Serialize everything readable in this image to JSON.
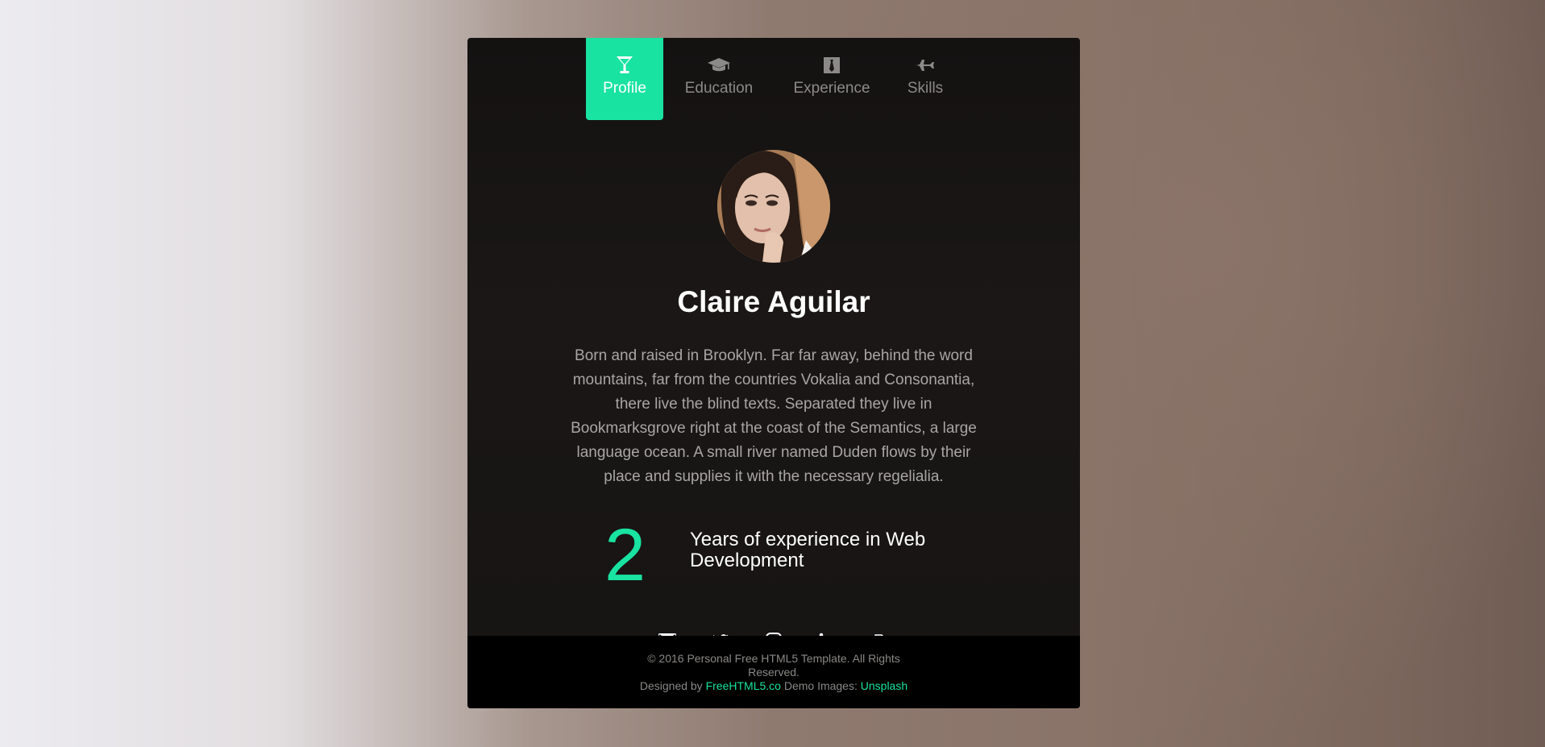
{
  "tabs": [
    {
      "label": "Profile",
      "icon": "cocktail-icon",
      "active": true
    },
    {
      "label": "Education",
      "icon": "graduation-cap-icon",
      "active": false
    },
    {
      "label": "Experience",
      "icon": "briefcase-icon",
      "active": false
    },
    {
      "label": "Skills",
      "icon": "airplane-icon",
      "active": false
    }
  ],
  "profile": {
    "name": "Claire Aguilar",
    "bio": "Born and raised in Brooklyn. Far far away, behind the word mountains, far from the countries Vokalia and Consonantia, there live the blind texts. Separated they live in Bookmarksgrove right at the coast of the Semantics, a large language ocean. A small river named Duden flows by their place and supplies it with the necessary regelialia.",
    "years_value": "2",
    "years_label": "Years of experience in Web Development"
  },
  "social": [
    "envelope-icon",
    "twitter-icon",
    "instagram-icon",
    "linkedin-icon",
    "file-download-icon"
  ],
  "footer": {
    "copyright": "© 2016 Personal Free HTML5 Template. All Rights Reserved.",
    "designed_by_prefix": "Designed by",
    "designed_by_link": "FreeHTML5.co",
    "images_prefix": "Demo Images:",
    "images_link": "Unsplash"
  },
  "colors": {
    "accent": "#19e3a1",
    "card_bg": "#161413",
    "footer_bg": "#000000"
  }
}
